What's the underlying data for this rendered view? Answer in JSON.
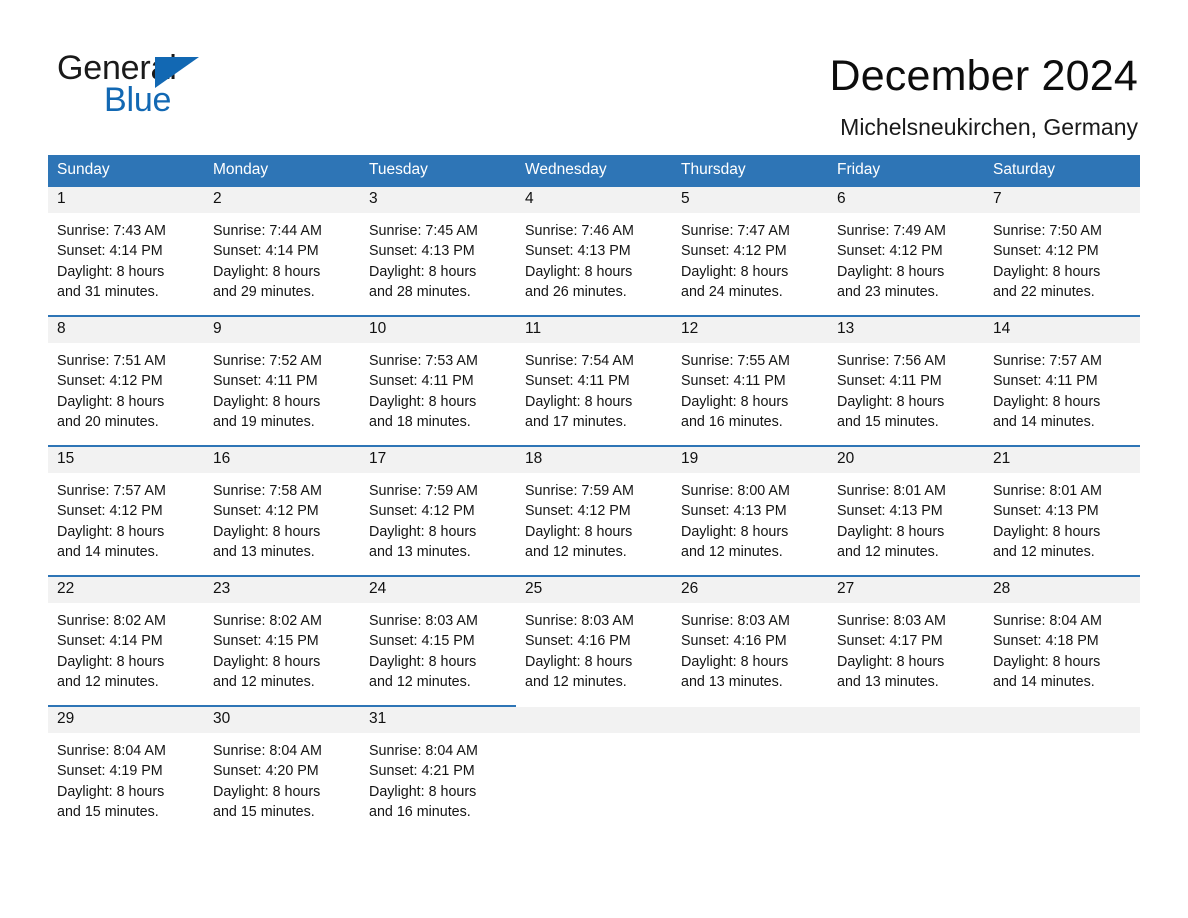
{
  "brand": {
    "name_part1": "General",
    "name_part2": "Blue"
  },
  "header": {
    "title": "December 2024",
    "location": "Michelsneukirchen, Germany"
  },
  "colors": {
    "header_blue": "#2e75b6",
    "brand_blue": "#1268b3",
    "daynum_band": "#f2f2f2"
  },
  "weekdays": [
    "Sunday",
    "Monday",
    "Tuesday",
    "Wednesday",
    "Thursday",
    "Friday",
    "Saturday"
  ],
  "weeks": [
    [
      {
        "day": "1",
        "sunrise": "Sunrise: 7:43 AM",
        "sunset": "Sunset: 4:14 PM",
        "daylight1": "Daylight: 8 hours",
        "daylight2": "and 31 minutes."
      },
      {
        "day": "2",
        "sunrise": "Sunrise: 7:44 AM",
        "sunset": "Sunset: 4:14 PM",
        "daylight1": "Daylight: 8 hours",
        "daylight2": "and 29 minutes."
      },
      {
        "day": "3",
        "sunrise": "Sunrise: 7:45 AM",
        "sunset": "Sunset: 4:13 PM",
        "daylight1": "Daylight: 8 hours",
        "daylight2": "and 28 minutes."
      },
      {
        "day": "4",
        "sunrise": "Sunrise: 7:46 AM",
        "sunset": "Sunset: 4:13 PM",
        "daylight1": "Daylight: 8 hours",
        "daylight2": "and 26 minutes."
      },
      {
        "day": "5",
        "sunrise": "Sunrise: 7:47 AM",
        "sunset": "Sunset: 4:12 PM",
        "daylight1": "Daylight: 8 hours",
        "daylight2": "and 24 minutes."
      },
      {
        "day": "6",
        "sunrise": "Sunrise: 7:49 AM",
        "sunset": "Sunset: 4:12 PM",
        "daylight1": "Daylight: 8 hours",
        "daylight2": "and 23 minutes."
      },
      {
        "day": "7",
        "sunrise": "Sunrise: 7:50 AM",
        "sunset": "Sunset: 4:12 PM",
        "daylight1": "Daylight: 8 hours",
        "daylight2": "and 22 minutes."
      }
    ],
    [
      {
        "day": "8",
        "sunrise": "Sunrise: 7:51 AM",
        "sunset": "Sunset: 4:12 PM",
        "daylight1": "Daylight: 8 hours",
        "daylight2": "and 20 minutes."
      },
      {
        "day": "9",
        "sunrise": "Sunrise: 7:52 AM",
        "sunset": "Sunset: 4:11 PM",
        "daylight1": "Daylight: 8 hours",
        "daylight2": "and 19 minutes."
      },
      {
        "day": "10",
        "sunrise": "Sunrise: 7:53 AM",
        "sunset": "Sunset: 4:11 PM",
        "daylight1": "Daylight: 8 hours",
        "daylight2": "and 18 minutes."
      },
      {
        "day": "11",
        "sunrise": "Sunrise: 7:54 AM",
        "sunset": "Sunset: 4:11 PM",
        "daylight1": "Daylight: 8 hours",
        "daylight2": "and 17 minutes."
      },
      {
        "day": "12",
        "sunrise": "Sunrise: 7:55 AM",
        "sunset": "Sunset: 4:11 PM",
        "daylight1": "Daylight: 8 hours",
        "daylight2": "and 16 minutes."
      },
      {
        "day": "13",
        "sunrise": "Sunrise: 7:56 AM",
        "sunset": "Sunset: 4:11 PM",
        "daylight1": "Daylight: 8 hours",
        "daylight2": "and 15 minutes."
      },
      {
        "day": "14",
        "sunrise": "Sunrise: 7:57 AM",
        "sunset": "Sunset: 4:11 PM",
        "daylight1": "Daylight: 8 hours",
        "daylight2": "and 14 minutes."
      }
    ],
    [
      {
        "day": "15",
        "sunrise": "Sunrise: 7:57 AM",
        "sunset": "Sunset: 4:12 PM",
        "daylight1": "Daylight: 8 hours",
        "daylight2": "and 14 minutes."
      },
      {
        "day": "16",
        "sunrise": "Sunrise: 7:58 AM",
        "sunset": "Sunset: 4:12 PM",
        "daylight1": "Daylight: 8 hours",
        "daylight2": "and 13 minutes."
      },
      {
        "day": "17",
        "sunrise": "Sunrise: 7:59 AM",
        "sunset": "Sunset: 4:12 PM",
        "daylight1": "Daylight: 8 hours",
        "daylight2": "and 13 minutes."
      },
      {
        "day": "18",
        "sunrise": "Sunrise: 7:59 AM",
        "sunset": "Sunset: 4:12 PM",
        "daylight1": "Daylight: 8 hours",
        "daylight2": "and 12 minutes."
      },
      {
        "day": "19",
        "sunrise": "Sunrise: 8:00 AM",
        "sunset": "Sunset: 4:13 PM",
        "daylight1": "Daylight: 8 hours",
        "daylight2": "and 12 minutes."
      },
      {
        "day": "20",
        "sunrise": "Sunrise: 8:01 AM",
        "sunset": "Sunset: 4:13 PM",
        "daylight1": "Daylight: 8 hours",
        "daylight2": "and 12 minutes."
      },
      {
        "day": "21",
        "sunrise": "Sunrise: 8:01 AM",
        "sunset": "Sunset: 4:13 PM",
        "daylight1": "Daylight: 8 hours",
        "daylight2": "and 12 minutes."
      }
    ],
    [
      {
        "day": "22",
        "sunrise": "Sunrise: 8:02 AM",
        "sunset": "Sunset: 4:14 PM",
        "daylight1": "Daylight: 8 hours",
        "daylight2": "and 12 minutes."
      },
      {
        "day": "23",
        "sunrise": "Sunrise: 8:02 AM",
        "sunset": "Sunset: 4:15 PM",
        "daylight1": "Daylight: 8 hours",
        "daylight2": "and 12 minutes."
      },
      {
        "day": "24",
        "sunrise": "Sunrise: 8:03 AM",
        "sunset": "Sunset: 4:15 PM",
        "daylight1": "Daylight: 8 hours",
        "daylight2": "and 12 minutes."
      },
      {
        "day": "25",
        "sunrise": "Sunrise: 8:03 AM",
        "sunset": "Sunset: 4:16 PM",
        "daylight1": "Daylight: 8 hours",
        "daylight2": "and 12 minutes."
      },
      {
        "day": "26",
        "sunrise": "Sunrise: 8:03 AM",
        "sunset": "Sunset: 4:16 PM",
        "daylight1": "Daylight: 8 hours",
        "daylight2": "and 13 minutes."
      },
      {
        "day": "27",
        "sunrise": "Sunrise: 8:03 AM",
        "sunset": "Sunset: 4:17 PM",
        "daylight1": "Daylight: 8 hours",
        "daylight2": "and 13 minutes."
      },
      {
        "day": "28",
        "sunrise": "Sunrise: 8:04 AM",
        "sunset": "Sunset: 4:18 PM",
        "daylight1": "Daylight: 8 hours",
        "daylight2": "and 14 minutes."
      }
    ],
    [
      {
        "day": "29",
        "sunrise": "Sunrise: 8:04 AM",
        "sunset": "Sunset: 4:19 PM",
        "daylight1": "Daylight: 8 hours",
        "daylight2": "and 15 minutes."
      },
      {
        "day": "30",
        "sunrise": "Sunrise: 8:04 AM",
        "sunset": "Sunset: 4:20 PM",
        "daylight1": "Daylight: 8 hours",
        "daylight2": "and 15 minutes."
      },
      {
        "day": "31",
        "sunrise": "Sunrise: 8:04 AM",
        "sunset": "Sunset: 4:21 PM",
        "daylight1": "Daylight: 8 hours",
        "daylight2": "and 16 minutes."
      },
      {
        "day": "",
        "sunrise": "",
        "sunset": "",
        "daylight1": "",
        "daylight2": ""
      },
      {
        "day": "",
        "sunrise": "",
        "sunset": "",
        "daylight1": "",
        "daylight2": ""
      },
      {
        "day": "",
        "sunrise": "",
        "sunset": "",
        "daylight1": "",
        "daylight2": ""
      },
      {
        "day": "",
        "sunrise": "",
        "sunset": "",
        "daylight1": "",
        "daylight2": ""
      }
    ]
  ]
}
